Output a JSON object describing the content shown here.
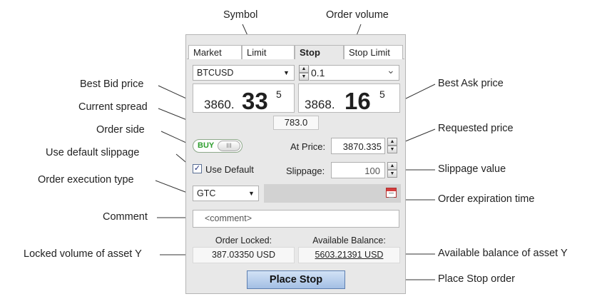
{
  "callouts": {
    "symbol": "Symbol",
    "order_volume": "Order volume",
    "best_bid_price": "Best Bid price",
    "current_spread": "Current spread",
    "order_side": "Order side",
    "use_default_slippage": "Use default slippage",
    "order_execution_type": "Order execution type",
    "comment": "Comment",
    "locked_volume": "Locked volume of asset Y",
    "best_ask_price": "Best Ask price",
    "requested_price": "Requested price",
    "slippage_value": "Slippage value",
    "order_expiration_time": "Order expiration time",
    "available_balance": "Available balance of asset Y",
    "place_stop_order": "Place  Stop order"
  },
  "tabs": [
    "Market",
    "Limit",
    "Stop",
    "Stop Limit"
  ],
  "active_tab": "Stop",
  "symbol": {
    "value": "BTCUSD"
  },
  "volume": {
    "value": "0.1"
  },
  "bid": {
    "prefix": "3860.",
    "big": "33",
    "sup": "5"
  },
  "ask": {
    "prefix": "3868.",
    "big": "16",
    "sup": "5"
  },
  "spread": "783.0",
  "side": {
    "label": "BUY",
    "knob": "III",
    "color": "#2e9e2e"
  },
  "at_price": {
    "label": "At Price:",
    "value": "3870.335"
  },
  "use_default": {
    "label": "Use Default",
    "checked": true,
    "mark": "✓"
  },
  "slippage": {
    "label": "Slippage:",
    "value": "100"
  },
  "execution_type": {
    "value": "GTC"
  },
  "comment": {
    "placeholder": "<comment>"
  },
  "order_locked": {
    "label": "Order Locked:",
    "value": "387.03350 USD"
  },
  "available_balance": {
    "label": "Available Balance:",
    "value": "5603.21391 USD"
  },
  "place_button": "Place Stop",
  "icons": {
    "dropdown": "▼",
    "spin_up": "▲",
    "spin_down": "▼",
    "chevron": "⌄",
    "calendar": "calendar-icon"
  }
}
